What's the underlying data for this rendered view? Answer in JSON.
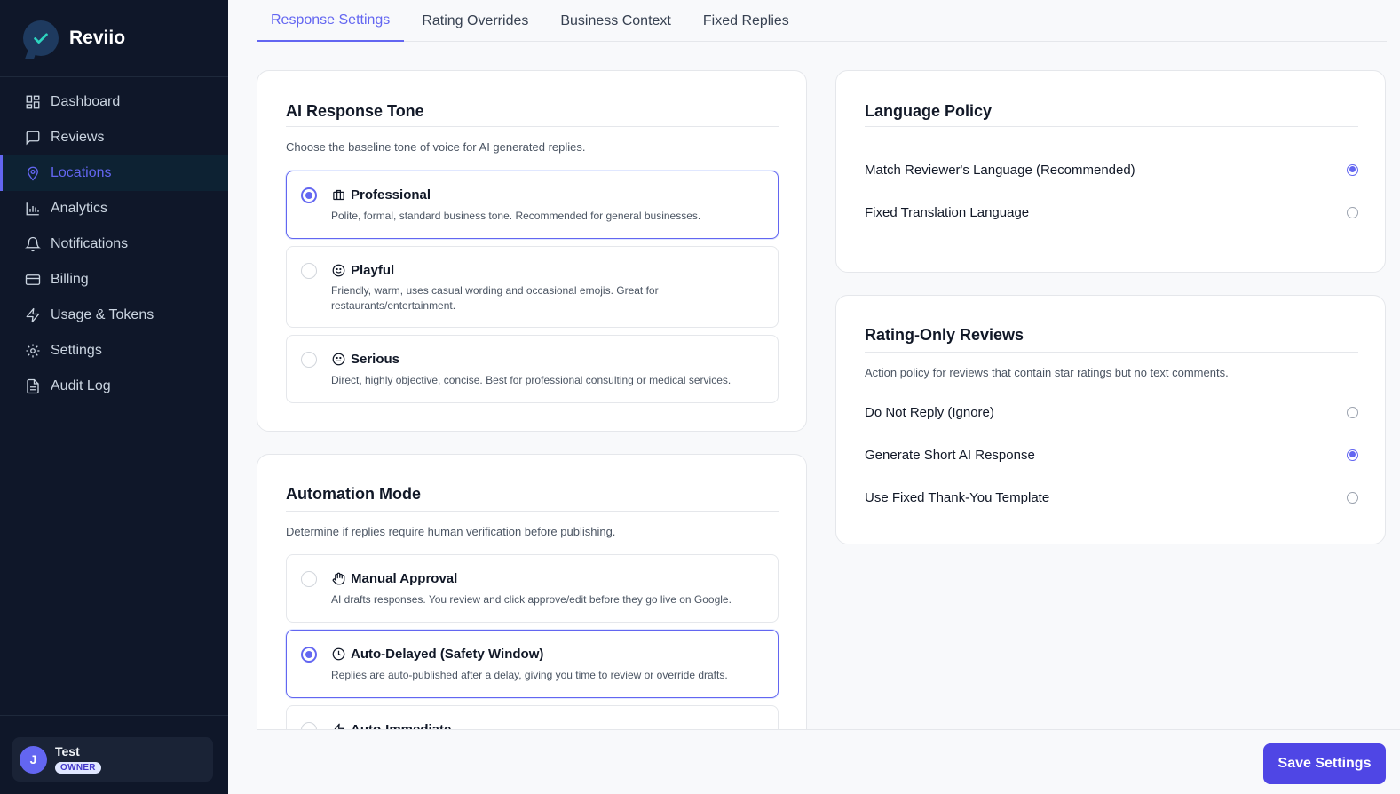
{
  "brand": {
    "name": "Reviio"
  },
  "sidebar": {
    "items": [
      {
        "label": "Dashboard",
        "icon": "dashboard-icon"
      },
      {
        "label": "Reviews",
        "icon": "message-square-icon"
      },
      {
        "label": "Locations",
        "icon": "map-pin-icon"
      },
      {
        "label": "Analytics",
        "icon": "bar-chart-icon"
      },
      {
        "label": "Notifications",
        "icon": "bell-icon"
      },
      {
        "label": "Billing",
        "icon": "credit-card-icon"
      },
      {
        "label": "Usage & Tokens",
        "icon": "zap-icon"
      },
      {
        "label": "Settings",
        "icon": "gear-icon"
      },
      {
        "label": "Audit Log",
        "icon": "file-text-icon"
      }
    ],
    "active_item": "Locations"
  },
  "user": {
    "initial": "J",
    "name": "Test",
    "role": "OWNER"
  },
  "tabs": [
    {
      "label": "Response Settings"
    },
    {
      "label": "Rating Overrides"
    },
    {
      "label": "Business Context"
    },
    {
      "label": "Fixed Replies"
    }
  ],
  "active_tab": "Response Settings",
  "tone": {
    "title": "AI Response Tone",
    "description": "Choose the baseline tone of voice for AI generated replies.",
    "options": [
      {
        "title": "Professional",
        "description": "Polite, formal, standard business tone. Recommended for general businesses.",
        "icon": "briefcase-icon"
      },
      {
        "title": "Playful",
        "description": "Friendly, warm, uses casual wording and occasional emojis. Great for restaurants/entertainment.",
        "icon": "smile-icon"
      },
      {
        "title": "Serious",
        "description": "Direct, highly objective, concise. Best for professional consulting or medical services.",
        "icon": "meh-icon"
      }
    ],
    "selected": "Professional"
  },
  "automation": {
    "title": "Automation Mode",
    "description": "Determine if replies require human verification before publishing.",
    "options": [
      {
        "title": "Manual Approval",
        "description": "AI drafts responses. You review and click approve/edit before they go live on Google.",
        "icon": "hand-icon"
      },
      {
        "title": "Auto-Delayed (Safety Window)",
        "description": "Replies are auto-published after a delay, giving you time to review or override drafts.",
        "icon": "clock-icon"
      },
      {
        "title": "Auto-Immediate",
        "description": "",
        "icon": "zap-icon"
      }
    ],
    "selected": "Auto-Delayed (Safety Window)"
  },
  "language_policy": {
    "title": "Language Policy",
    "options": [
      {
        "label": "Match Reviewer's Language (Recommended)"
      },
      {
        "label": "Fixed Translation Language"
      }
    ],
    "selected": "Match Reviewer's Language (Recommended)"
  },
  "rating_only": {
    "title": "Rating-Only Reviews",
    "description": "Action policy for reviews that contain star ratings but no text comments.",
    "options": [
      {
        "label": "Do Not Reply (Ignore)"
      },
      {
        "label": "Generate Short AI Response"
      },
      {
        "label": "Use Fixed Thank-You Template"
      }
    ],
    "selected": "Generate Short AI Response"
  },
  "actions": {
    "save_label": "Save Settings"
  },
  "colors": {
    "accent": "#6366f1",
    "sidebar_bg": "#0f1729",
    "save_button": "#4f46e5"
  }
}
